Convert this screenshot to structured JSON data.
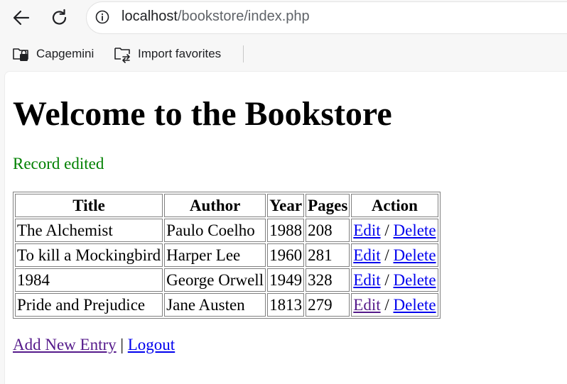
{
  "browser": {
    "url_host": "localhost",
    "url_path": "/bookstore/index.php",
    "icons": [
      "back-arrow-icon",
      "reload-icon",
      "info-icon"
    ]
  },
  "favorites": [
    {
      "label": "Capgemini",
      "icon": "folder-lock-icon"
    },
    {
      "label": "Import favorites",
      "icon": "folder-import-icon"
    }
  ],
  "page": {
    "title": "Welcome to the Bookstore",
    "status": "Record edited",
    "status_color": "#008000"
  },
  "table": {
    "headers": [
      "Title",
      "Author",
      "Year",
      "Pages",
      "Action"
    ],
    "rows": [
      {
        "title": "The Alchemist",
        "author": "Paulo Coelho",
        "year": "1988",
        "pages": "208",
        "edit": "Edit",
        "sep": "/",
        "delete": "Delete"
      },
      {
        "title": "To kill a Mockingbird",
        "author": "Harper Lee",
        "year": "1960",
        "pages": "281",
        "edit": "Edit",
        "sep": "/",
        "delete": "Delete"
      },
      {
        "title": "1984",
        "author": "George Orwell",
        "year": "1949",
        "pages": "328",
        "edit": "Edit",
        "sep": "/",
        "delete": "Delete"
      },
      {
        "title": "Pride and Prejudice",
        "author": "Jane Austen",
        "year": "1813",
        "pages": "279",
        "edit": "Edit",
        "sep": "/",
        "delete": "Delete"
      }
    ]
  },
  "links": {
    "add": "Add New Entry",
    "sep": "|",
    "logout": "Logout"
  },
  "colors": {
    "link": "#0000ee",
    "visited_link": "#551a8b"
  }
}
